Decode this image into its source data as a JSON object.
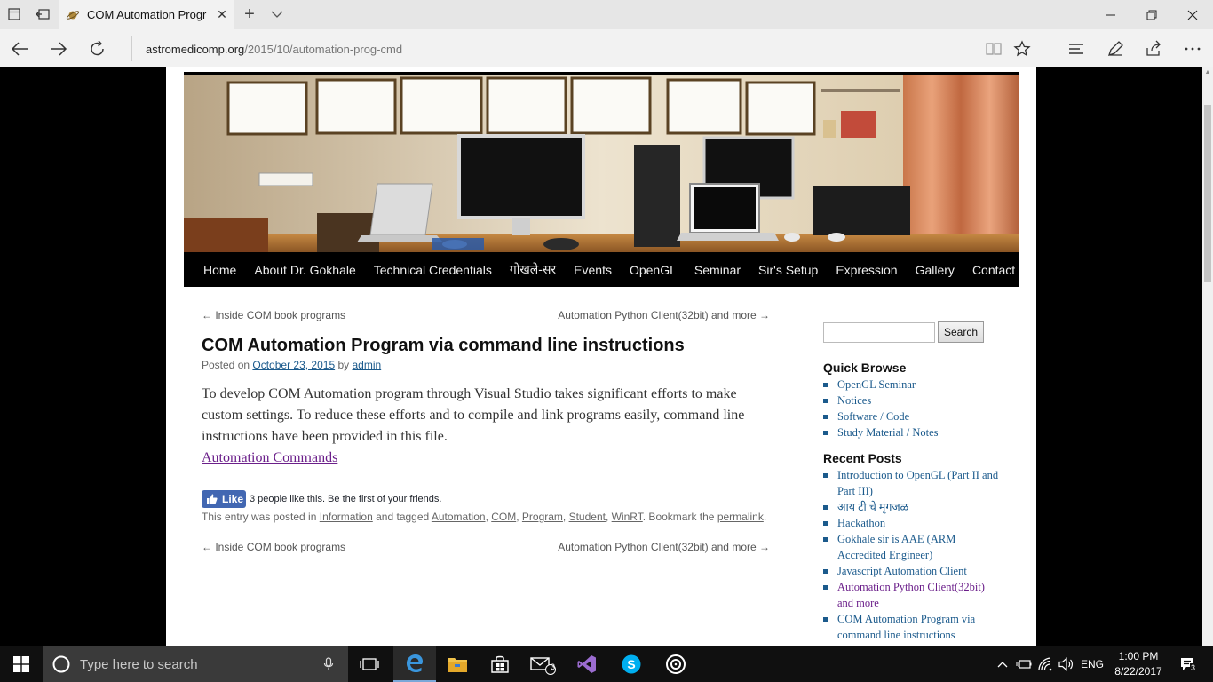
{
  "browser": {
    "tab_title": "COM Automation Progr",
    "url_domain": "astromedicomp.org",
    "url_path": "/2015/10/automation-prog-cmd"
  },
  "site": {
    "nav": [
      "Home",
      "About Dr. Gokhale",
      "Technical Credentials",
      "गोखले-सर",
      "Events",
      "OpenGL",
      "Seminar",
      "Sir's Setup",
      "Expression",
      "Gallery",
      "Contact"
    ]
  },
  "post": {
    "prev_link": "← Inside COM book programs",
    "next_link": "Automation Python Client(32bit) and more →",
    "title": "COM Automation Program via command line instructions",
    "posted_on_label": "Posted on",
    "date": "October 23, 2015",
    "by_label": "by",
    "author": "admin",
    "body": "To develop COM Automation program through Visual Studio takes significant efforts to make custom settings. To reduce these efforts and to compile and link programs easily, command line instructions have been provided in this file.",
    "link_text": "Automation Commands",
    "fb_like": "Like",
    "fb_text": "3 people like this. Be the first of your friends.",
    "entry_prefix": "This entry was posted in",
    "category": "Information",
    "tagged_label": "and tagged",
    "tags": [
      "Automation",
      "COM",
      "Program",
      "Student",
      "WinRT"
    ],
    "bookmark_label": ". Bookmark the",
    "permalink": "permalink",
    "end_dot": "."
  },
  "sidebar": {
    "search_button": "Search",
    "quick_browse_title": "Quick Browse",
    "quick_browse": [
      "OpenGL Seminar",
      "Notices",
      "Software / Code",
      "Study Material / Notes"
    ],
    "recent_title": "Recent Posts",
    "recent": [
      "Introduction to OpenGL (Part II and Part III)",
      "आय टी चे मृगजळ",
      "Hackathon",
      "Gokhale sir is AAE (ARM Accredited Engineer)",
      "Javascript Automation Client",
      "Automation Python Client(32bit) and more",
      "COM Automation Program via command line instructions"
    ]
  },
  "taskbar": {
    "search_placeholder": "Type here to search",
    "language": "ENG",
    "time": "1:00 PM",
    "date": "8/22/2017",
    "mail_badge": "3",
    "notification_count": "3"
  },
  "colors": {
    "link_blue": "#1b5a8c",
    "link_visited": "#6b1f8a",
    "nav_bg": "#000000",
    "fb_blue": "#4267b2"
  }
}
